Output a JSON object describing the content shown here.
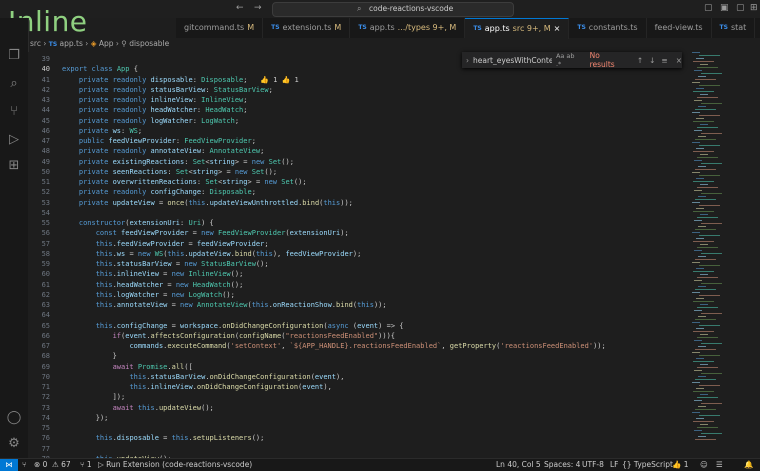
{
  "overlay_title": "Inline",
  "window_title": "code-reactions-vscode",
  "tabs": [
    {
      "label": "gitcommand.ts",
      "badge": "M",
      "icon": "",
      "active": false
    },
    {
      "label": "extension.ts",
      "badge": "M",
      "icon": "TS",
      "active": false
    },
    {
      "label": "app.ts",
      "badge": ".../types 9+, M",
      "icon": "TS",
      "active": false
    },
    {
      "label": "app.ts",
      "badge": "src 9+, M",
      "icon": "TS",
      "active": true
    },
    {
      "label": "constants.ts",
      "badge": "",
      "icon": "TS",
      "active": false
    },
    {
      "label": "feed-view.ts",
      "badge": "",
      "icon": "",
      "active": false
    },
    {
      "label": "stat",
      "badge": "",
      "icon": "TS",
      "active": false
    }
  ],
  "breadcrumb": [
    "src",
    "app.ts",
    "App",
    "disposable"
  ],
  "find": {
    "query": "heart_eyesWithContent",
    "options": "Aa  ab  .*",
    "result": "No results"
  },
  "code_lines": [
    {
      "n": "39",
      "t": "    "
    },
    {
      "n": "40",
      "t": "export class App {"
    },
    {
      "n": "41",
      "t": "    private readonly disposable: Disposable;   👍 1 👍 1"
    },
    {
      "n": "42",
      "t": "    private readonly statusBarView: StatusBarView;"
    },
    {
      "n": "43",
      "t": "    private readonly inlineView: InlineView;"
    },
    {
      "n": "44",
      "t": "    private readonly headWatcher: HeadWatch;"
    },
    {
      "n": "45",
      "t": "    private readonly logWatcher: LogWatch;"
    },
    {
      "n": "46",
      "t": "    private ws: WS;"
    },
    {
      "n": "47",
      "t": "    public feedViewProvider: FeedViewProvider;"
    },
    {
      "n": "48",
      "t": "    private readonly annotateView: AnnotateView;"
    },
    {
      "n": "49",
      "t": "    private existingReactions: Set<string> = new Set();"
    },
    {
      "n": "50",
      "t": "    private seenReactions: Set<string> = new Set();"
    },
    {
      "n": "51",
      "t": "    private overwrittenReactions: Set<string> = new Set();"
    },
    {
      "n": "52",
      "t": "    private readonly configChange: Disposable;"
    },
    {
      "n": "53",
      "t": "    private updateView = once(this.updateViewUnthrottled.bind(this));"
    },
    {
      "n": "54",
      "t": ""
    },
    {
      "n": "55",
      "t": "    constructor(extensionUri: Uri) {"
    },
    {
      "n": "56",
      "t": "        const feedViewProvider = new FeedViewProvider(extensionUri);"
    },
    {
      "n": "57",
      "t": "        this.feedViewProvider = feedViewProvider;"
    },
    {
      "n": "58",
      "t": "        this.ws = new WS(this.updateView.bind(this), feedViewProvider);"
    },
    {
      "n": "59",
      "t": "        this.statusBarView = new StatusBarView();"
    },
    {
      "n": "60",
      "t": "        this.inlineView = new InlineView();"
    },
    {
      "n": "61",
      "t": "        this.headWatcher = new HeadWatch();"
    },
    {
      "n": "62",
      "t": "        this.logWatcher = new LogWatch();"
    },
    {
      "n": "63",
      "t": "        this.annotateView = new AnnotateView(this.onReactionShow.bind(this));"
    },
    {
      "n": "64",
      "t": ""
    },
    {
      "n": "65",
      "t": "        this.configChange = workspace.onDidChangeConfiguration(async (event) => {"
    },
    {
      "n": "66",
      "t": "            if(event.affectsConfiguration(configName(\"reactionsFeedEnabled\"))){"
    },
    {
      "n": "67",
      "t": "                commands.executeCommand('setContext', `${APP_HANDLE}.reactionsFeedEnabled`, getProperty('reactionsFeedEnabled'));"
    },
    {
      "n": "68",
      "t": "            }"
    },
    {
      "n": "69",
      "t": "            await Promise.all(["
    },
    {
      "n": "70",
      "t": "                this.statusBarView.onDidChangeConfiguration(event),"
    },
    {
      "n": "71",
      "t": "                this.inlineView.onDidChangeConfiguration(event),"
    },
    {
      "n": "72",
      "t": "            ]);"
    },
    {
      "n": "73",
      "t": "            await this.updateView();"
    },
    {
      "n": "74",
      "t": "        });"
    },
    {
      "n": "75",
      "t": ""
    },
    {
      "n": "76",
      "t": "        this.disposable = this.setupListeners();"
    },
    {
      "n": "77",
      "t": ""
    },
    {
      "n": "78",
      "t": "        this.updateView();"
    }
  ],
  "current_line": "40",
  "status": {
    "branch": "⑂",
    "errors": "⊗ 0",
    "warnings": "⚠ 67",
    "ports": "⑂ 1",
    "run": "▷ Run Extension (code-reactions-vscode)",
    "position": "Ln 40, Col 5",
    "spaces": "Spaces: 4",
    "encoding": "UTF-8",
    "eol": "LF",
    "language": "{} TypeScript",
    "reactions": "👍 1"
  },
  "colors": {
    "accent": "#0078d4",
    "editor_bg": "#1e1e1e",
    "keyword": "#569cd6",
    "type": "#4ec9b0"
  }
}
